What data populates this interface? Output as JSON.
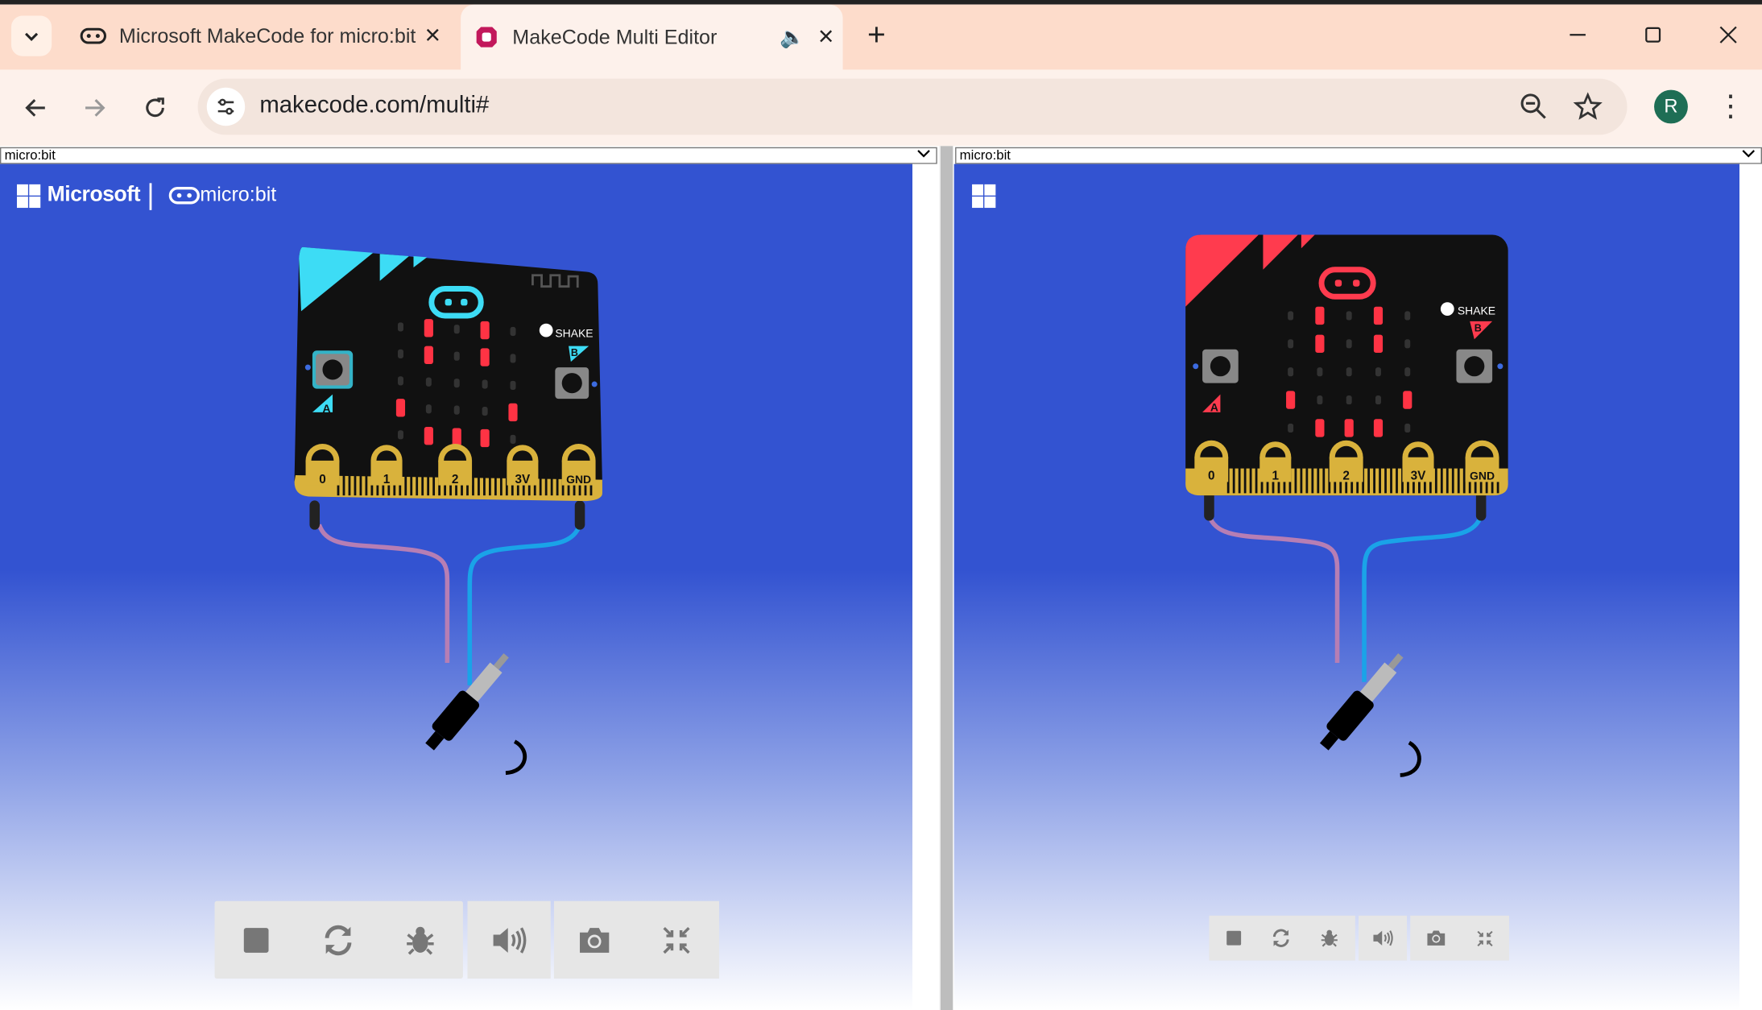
{
  "browser": {
    "tabs": [
      {
        "title": "Microsoft MakeCode for micro:bit"
      },
      {
        "title": "MakeCode Multi Editor"
      }
    ],
    "url": "makecode.com/multi#",
    "profile_initial": "R"
  },
  "simulators": [
    {
      "device_select": "micro:bit",
      "brand_microsoft": "Microsoft",
      "brand_microbit": "micro:bit",
      "board_color": "#3ddcf5",
      "pin_labels": [
        "0",
        "1",
        "2",
        "3V",
        "GND"
      ],
      "shake_label": "SHAKE",
      "button_a": "A",
      "button_b": "B",
      "controls": [
        "stop-icon",
        "restart-icon",
        "debug-icon",
        "sound-icon",
        "screenshot-icon",
        "fullscreen-icon"
      ]
    },
    {
      "device_select": "micro:bit",
      "board_color": "#ff3b4e",
      "pin_labels": [
        "0",
        "1",
        "2",
        "3V",
        "GND"
      ],
      "shake_label": "SHAKE",
      "button_a": "A",
      "button_b": "B",
      "controls": [
        "stop-icon",
        "restart-icon",
        "debug-icon",
        "sound-icon",
        "screenshot-icon",
        "fullscreen-icon"
      ]
    }
  ],
  "colors": {
    "sim_background": "#3353d1",
    "led_on": "#ff3344",
    "board": "#111111",
    "edge_gold": "#d9b23c"
  }
}
